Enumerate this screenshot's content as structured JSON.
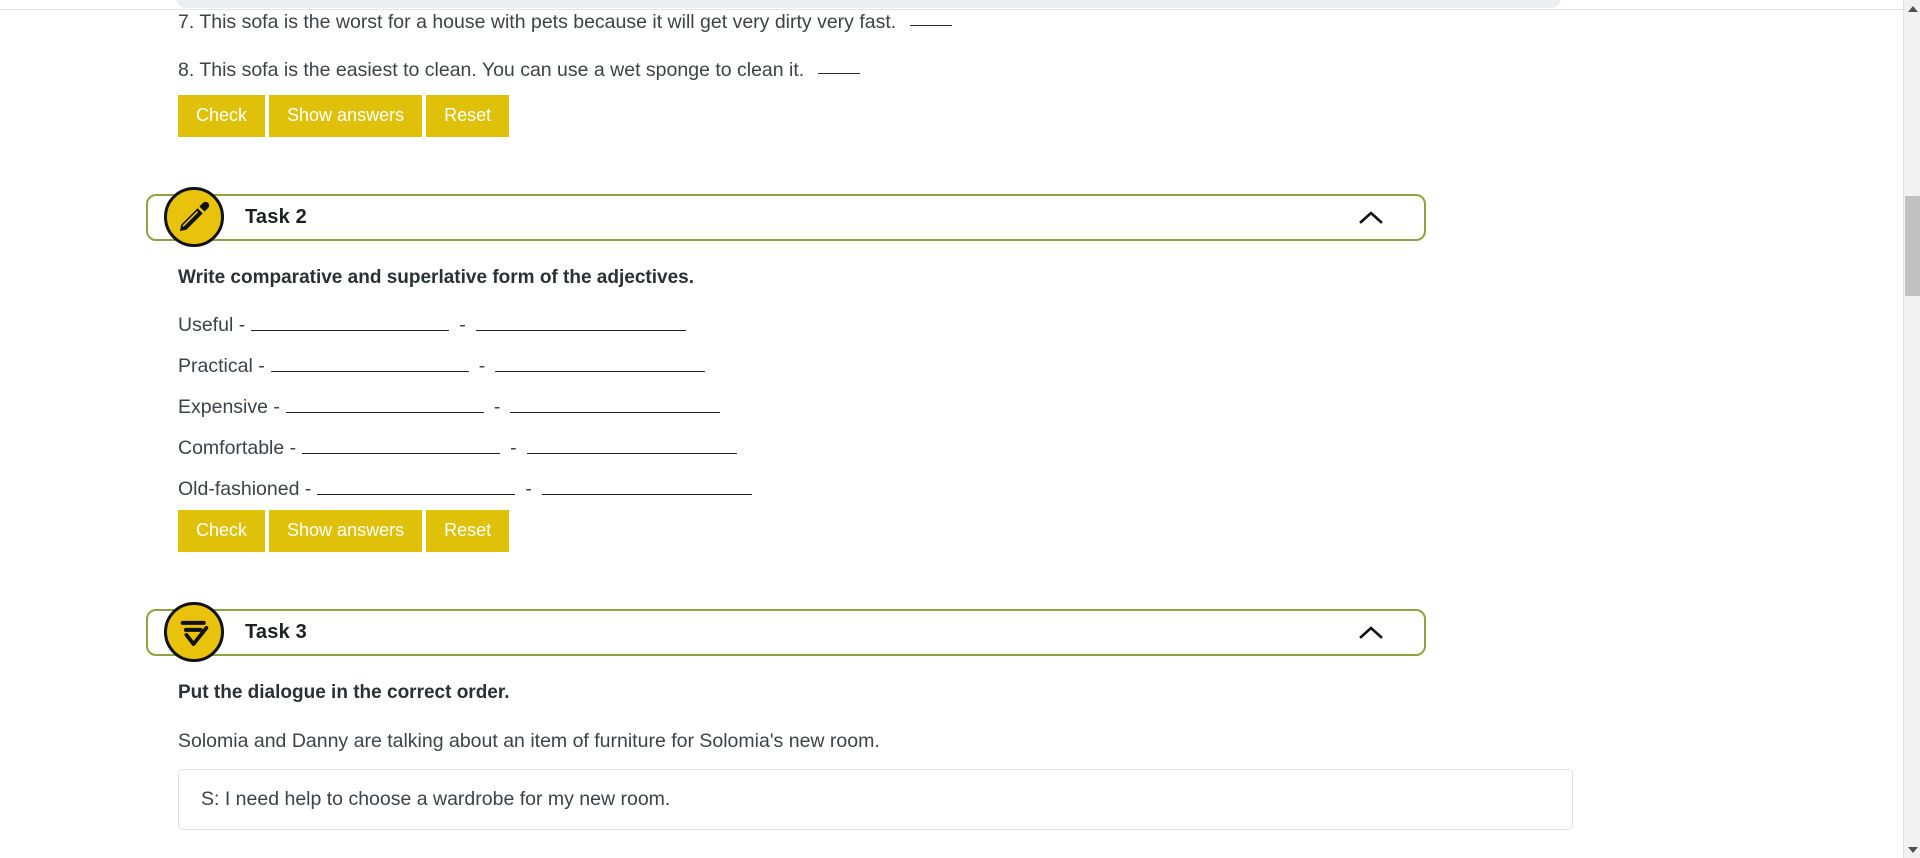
{
  "page": {
    "background_color": "#ffffff",
    "accent_yellow": "#e0c10a",
    "accent_green": "#8ea33f",
    "text_color": "#3d4246"
  },
  "task1_tail": {
    "items": [
      "7. This sofa is the worst for a house with pets because it will get very dirty very fast.",
      "8. This sofa is the easiest to clean. You can use a wet sponge to clean it."
    ],
    "buttons": {
      "check": "Check",
      "show_answers": "Show answers",
      "reset": "Reset"
    }
  },
  "task2": {
    "icon": "pencil-icon",
    "title": "Task 2",
    "collapse_icon": "chevron-up-icon",
    "prompt": "Write comparative and superlative form of the adjectives.",
    "separator": "-",
    "rows": [
      {
        "adjective": "Useful -",
        "comparative": "",
        "superlative": "",
        "w1": 200,
        "w2": 210
      },
      {
        "adjective": "Practical  -",
        "comparative": "",
        "superlative": "",
        "w1": 200,
        "w2": 210
      },
      {
        "adjective": "Expensive -",
        "comparative": "",
        "superlative": "",
        "w1": 200,
        "w2": 210
      },
      {
        "adjective": "Comfortable -",
        "comparative": "",
        "superlative": "",
        "w1": 200,
        "w2": 210
      },
      {
        "adjective": "Old-fashioned -",
        "comparative": "",
        "superlative": "",
        "w1": 200,
        "w2": 210
      }
    ],
    "buttons": {
      "check": "Check",
      "show_answers": "Show answers",
      "reset": "Reset"
    }
  },
  "task3": {
    "icon": "sort-order-icon",
    "title": "Task 3",
    "collapse_icon": "chevron-up-icon",
    "prompt": "Put the dialogue in the correct order.",
    "intro": "Solomia and Danny are talking about an item of furniture for Solomia's new room.",
    "dialogue_items": [
      "S: I need help to choose a wardrobe for my new room."
    ]
  },
  "scrollbar": {
    "up_arrow": "scroll-up-arrow",
    "down_arrow": "scroll-down-arrow",
    "thumb": "scroll-thumb"
  }
}
